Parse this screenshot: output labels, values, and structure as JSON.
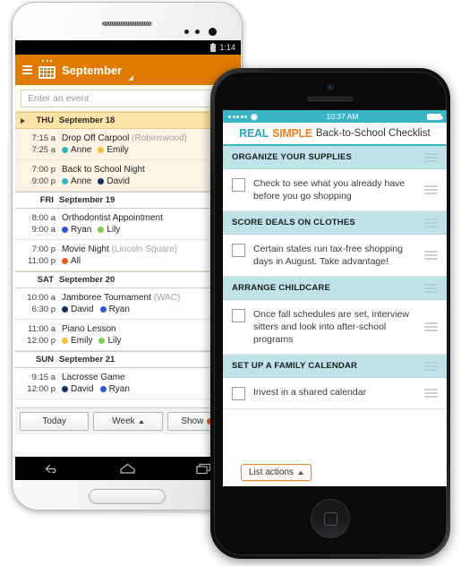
{
  "android": {
    "status": {
      "time": "1:14",
      "battery_icon": "battery-icon"
    },
    "appbar": {
      "menu_icon": "hamburger-menu-icon",
      "calendar_icon": "calendar-icon",
      "title": "September",
      "caret_icon": "chevron-down-icon"
    },
    "event_input": {
      "placeholder": "Enter an event",
      "value": ""
    },
    "days": [
      {
        "abbr": "THU",
        "date": "September 18",
        "today": true,
        "events": [
          {
            "start": "7:15 a",
            "end": "7:25 a",
            "title": "Drop Off Carpool",
            "location": "(Robinswood)",
            "people": [
              {
                "name": "Anne",
                "color": "#31b3c9"
              },
              {
                "name": "Emily",
                "color": "#f5c242"
              }
            ]
          },
          {
            "start": "7:00 p",
            "end": "9:00 p",
            "title": "Back to School Night",
            "location": "",
            "people": [
              {
                "name": "Anne",
                "color": "#31b3c9"
              },
              {
                "name": "David",
                "color": "#10305e"
              }
            ]
          }
        ]
      },
      {
        "abbr": "FRI",
        "date": "September 19",
        "today": false,
        "events": [
          {
            "start": "8:00 a",
            "end": "9:00 a",
            "title": "Orthodontist Appointment",
            "location": "",
            "people": [
              {
                "name": "Ryan",
                "color": "#2b56d8"
              },
              {
                "name": "Lily",
                "color": "#7dcc4a"
              }
            ]
          },
          {
            "start": "7:00 p",
            "end": "11:00 p",
            "title": "Movie Night",
            "location": "(Lincoln Square)",
            "people": [
              {
                "name": "All",
                "color": "#ec5a13"
              }
            ]
          }
        ]
      },
      {
        "abbr": "SAT",
        "date": "September 20",
        "today": false,
        "events": [
          {
            "start": "10:00 a",
            "end": "6:30 p",
            "title": "Jamboree Tournament",
            "location": "(WAC)",
            "people": [
              {
                "name": "David",
                "color": "#10305e"
              },
              {
                "name": "Ryan",
                "color": "#2b56d8"
              }
            ]
          },
          {
            "start": "11:00 a",
            "end": "12:00 p",
            "title": "Piano Lesson",
            "location": "",
            "people": [
              {
                "name": "Emily",
                "color": "#f5c242"
              },
              {
                "name": "Lily",
                "color": "#7dcc4a"
              }
            ]
          }
        ]
      },
      {
        "abbr": "SUN",
        "date": "September 21",
        "today": false,
        "events": [
          {
            "start": "9:15 a",
            "end": "12:00 p",
            "title": "Lacrosse Game",
            "location": "",
            "people": [
              {
                "name": "David",
                "color": "#10305e"
              },
              {
                "name": "Ryan",
                "color": "#2b56d8"
              }
            ]
          }
        ]
      }
    ],
    "buttons": {
      "today": "Today",
      "week": "Week",
      "show": "Show",
      "show_dot_color": "#ec5a13"
    },
    "nav": {
      "back_icon": "back-arrow-icon",
      "home_icon": "home-icon",
      "recents_icon": "recent-apps-icon"
    }
  },
  "iphone": {
    "status": {
      "time": "10:37 AM",
      "signal_icon": "signal-dots-icon",
      "wifi_icon": "wifi-icon",
      "battery_icon": "battery-icon"
    },
    "brand": {
      "real": "REAL",
      "simple": "SIMPLE",
      "rest": "Back-to-School Checklist"
    },
    "sections": [
      {
        "heading": "ORGANIZE YOUR SUPPLIES",
        "item": "Check to see what you already have before you go shopping"
      },
      {
        "heading": "SCORE DEALS ON CLOTHES",
        "item": "Certain states run tax-free shopping days in August. Take advantage!"
      },
      {
        "heading": "ARRANGE CHILDCARE",
        "item": "Once fall schedules are set, interview sitters and look into after-school programs"
      },
      {
        "heading": "SET UP A FAMILY CALENDAR",
        "item": "Invest in a shared calendar"
      }
    ],
    "list_actions": {
      "label": "List actions",
      "caret_icon": "chevron-up-icon"
    },
    "home_button_icon": "home-square-icon"
  },
  "colors": {
    "android_accent": "#e07b00",
    "iphone_accent": "#39b4c6",
    "brand_orange": "#f07f28"
  }
}
